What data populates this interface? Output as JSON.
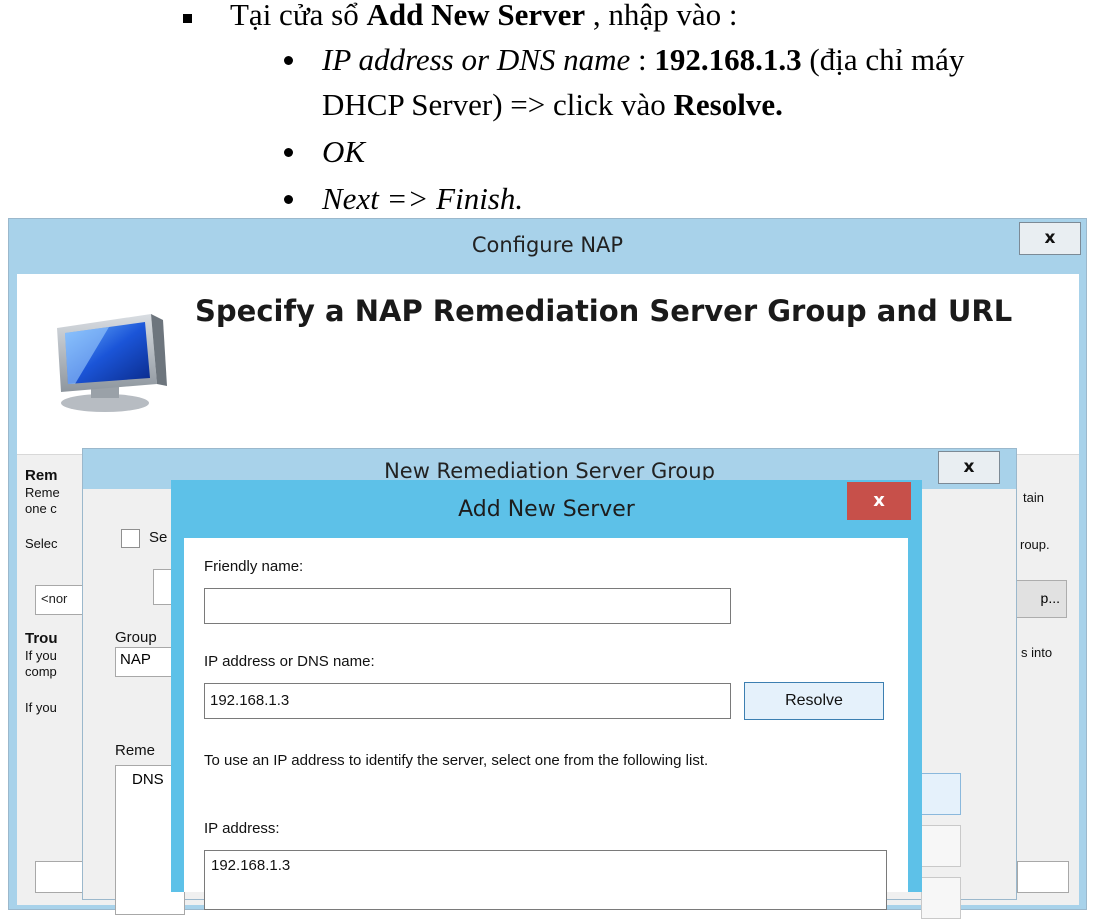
{
  "doc": {
    "line1": {
      "a": "Tại cửa sổ ",
      "b": "Add New Server",
      "c": " , nhập vào :"
    },
    "line2": {
      "a": "IP address or DNS name",
      "b": " : ",
      "c": "192.168.1.3",
      "d": " (địa chỉ máy"
    },
    "line3": {
      "a": "DHCP Server) => click vào ",
      "b": "Resolve."
    },
    "line4": "OK",
    "line5": "Next => Finish."
  },
  "nap_window": {
    "title": "Configure NAP",
    "close": "x",
    "heading": "Specify a NAP Remediation Server Group and URL",
    "body_fragments": {
      "rem": "Rem",
      "reme": "Reme",
      "one_c": "one c",
      "selec": "Selec",
      "combo_value": "<nor",
      "trou": "Trou",
      "if_you_1": "If you",
      "comp": "comp",
      "if_you_2": "If you",
      "tain": "tain",
      "roup": "roup.",
      "p_button": "p...",
      "s_into": "s into"
    }
  },
  "group_window": {
    "title": "New Remediation Server Group",
    "close": "x",
    "checkbox_label_fragment": "Se",
    "group_label_fragment": "Group",
    "group_value_fragment": "NAP",
    "reme_label_fragment": "Reme",
    "list_fragment": "DNS"
  },
  "add_server": {
    "title": "Add New Server",
    "close": "x",
    "friendly_label": "Friendly name:",
    "friendly_value": "",
    "ip_label": "IP address or DNS name:",
    "ip_value": "192.168.1.3",
    "resolve_button": "Resolve",
    "hint": "To use an IP address to identify the server, select one from the following list.",
    "ip_list_label": "IP address:",
    "ip_list": [
      "192.168.1.3"
    ]
  }
}
